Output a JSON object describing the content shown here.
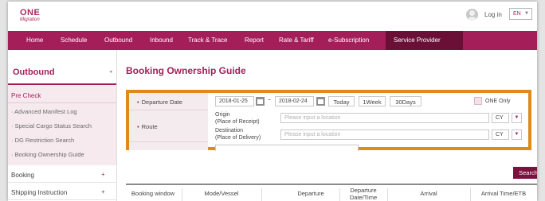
{
  "header": {
    "logo_line1": "ONE",
    "logo_line2": "Migration",
    "login": "Log in",
    "language": "EN"
  },
  "nav": {
    "items": [
      "Home",
      "Schedule",
      "Outbound",
      "Inbound",
      "Track & Trace",
      "Report",
      "Rate & Tariff",
      "e-Subscription",
      "Service Provider"
    ],
    "active": "Service Provider"
  },
  "sidebar": {
    "section": "Outbound",
    "group": "Pre Check",
    "subitems": [
      "· Advanced Manifest Log",
      "· Special Cargo Status Search",
      "· DG Restriction Search",
      "· Booking Ownership Guide"
    ],
    "items": [
      {
        "label": "Booking",
        "toggle": "+"
      },
      {
        "label": "Shipping Instruction",
        "toggle": "+"
      }
    ]
  },
  "main": {
    "page_title": "Booking Ownership Guide",
    "departure_label": "Departure Date",
    "date_from": "2018-01-25",
    "date_sep": "~",
    "date_to": "2018-02-24",
    "btn_today": "Today",
    "btn_1week": "1Week",
    "btn_30days": "30Days",
    "one_only": "ONE Only",
    "route_label": "Route",
    "origin_label": "Origin",
    "origin_sub": "(Place of Receipt)",
    "origin_placeholder": "Please input a location",
    "origin_type": "CY",
    "dest_label": "Destination",
    "dest_sub": "(Place of Delivery)",
    "dest_placeholder": "Please input a location",
    "dest_type": "CY",
    "search": "Search"
  },
  "table": {
    "headers": [
      "Booking window",
      "Mode/Vessel",
      "Departure",
      "Departure\nDate/Time",
      "Arrival",
      "Arrival Time/ETB"
    ]
  },
  "colors": {
    "brand": "#a41e5a",
    "highlight": "#e08a19",
    "active_nav": "#6a0f36"
  }
}
